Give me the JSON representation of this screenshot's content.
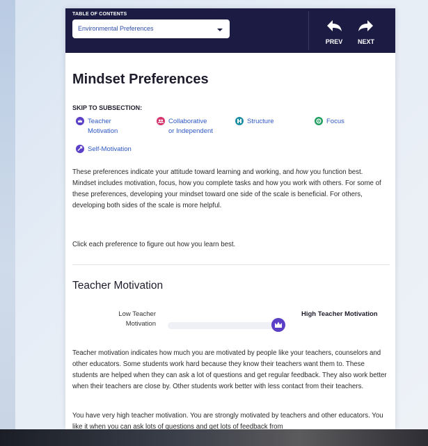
{
  "header": {
    "toc_label": "TABLE OF CONTENTS",
    "toc_selected": "Environmental Preferences",
    "prev_label": "PREV",
    "next_label": "NEXT"
  },
  "section": {
    "title": "Mindset Preferences",
    "skip_label": "SKIP TO SUBSECTION:",
    "subsections": [
      {
        "label_line1": "Teacher",
        "label_line2": "Motivation",
        "icon": "crown-icon",
        "color": "#5b3fc7"
      },
      {
        "label_line1": "Collaborative",
        "label_line2": "or Independent",
        "icon": "group-icon",
        "color": "#d6336c"
      },
      {
        "label_line1": "Structure",
        "label_line2": "",
        "icon": "structure-icon",
        "color": "#1f8fa3"
      },
      {
        "label_line1": "Focus",
        "label_line2": "",
        "icon": "focus-icon",
        "color": "#1f9e5f"
      },
      {
        "label_line1": "Self-Motivation",
        "label_line2": "",
        "icon": "self-motivation-icon",
        "color": "#5b3fc7"
      }
    ],
    "intro_a": "These preferences indicate your attitude toward learning and working, and ",
    "intro_em": "how",
    "intro_b": " you function best. Mindset includes motivation, focus, how you complete tasks and how you work with others. For some of these preferences, developing your mindset toward one side of the scale is beneficial. For others, developing both sides of the scale is more helpful.",
    "instruction": "Click each preference to figure out how you learn best."
  },
  "teacher_motivation": {
    "title": "Teacher Motivation",
    "low_label": "Low Teacher Motivation",
    "high_label": "High Teacher Motivation",
    "level_fraction": 0.95,
    "description": "Teacher motivation indicates how much you are motivated by people like your teachers, counselors and other educators. Some students work hard because they know their teachers want them to. These students are helped when they can ask a lot of questions and get regular feedback. They also work better when their teachers are close by. Other students work better with less contact from their teachers.",
    "result": "You have very high teacher motivation. You are strongly motivated by teachers and other educators. You like it when you can ask lots of questions and get lots of feedback from"
  }
}
